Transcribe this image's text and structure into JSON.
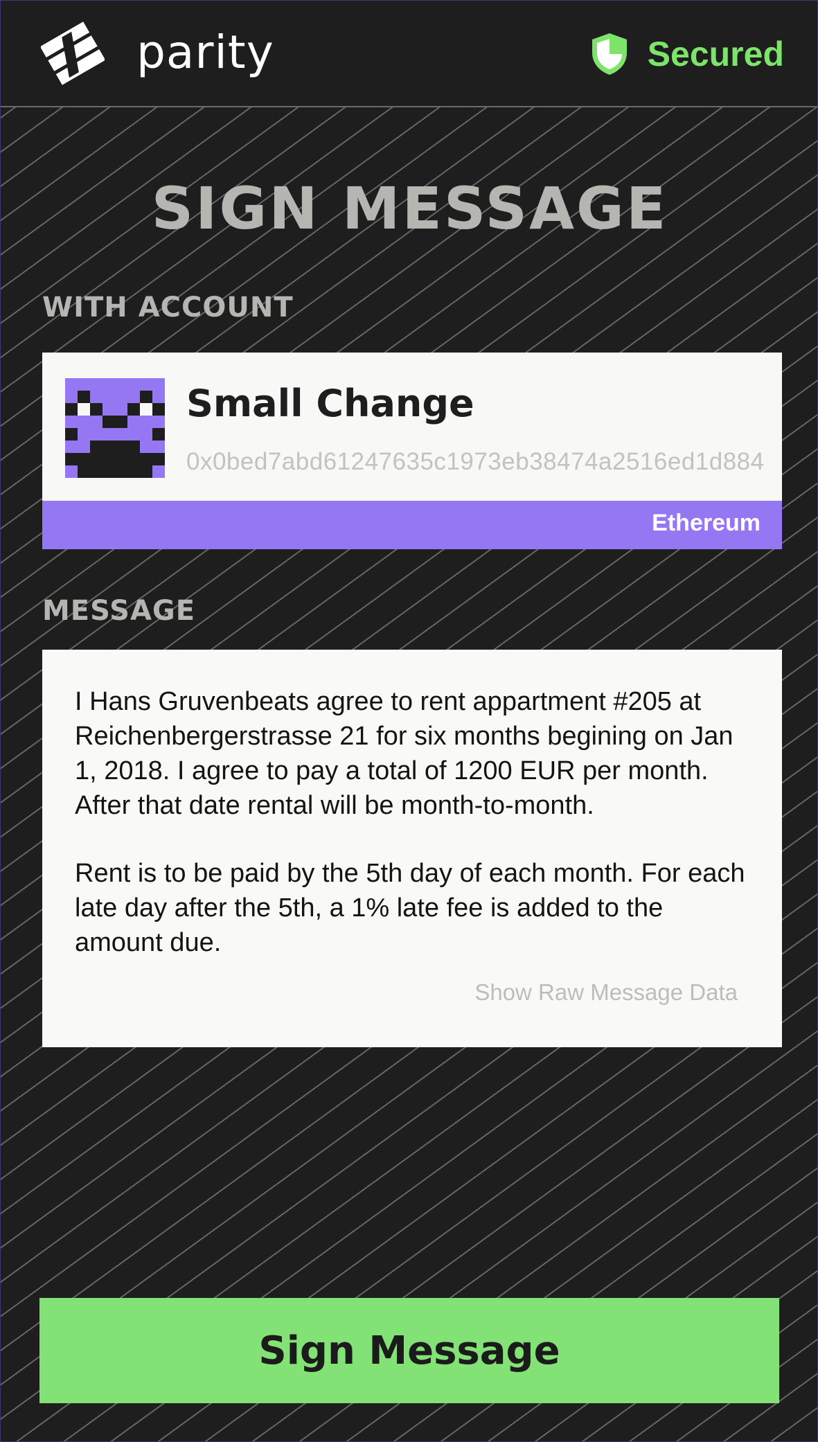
{
  "header": {
    "brand": "parity",
    "logo_icon": "parity-logo-icon",
    "status_icon": "shield-icon",
    "status_label": "Secured",
    "status_color": "#7de36a"
  },
  "page": {
    "title": "SIGN MESSAGE"
  },
  "account_section": {
    "label": "WITH ACCOUNT",
    "account": {
      "name": "Small Change",
      "address": "0x0bed7abd61247635c1973eb38474a2516ed1d884",
      "network": "Ethereum",
      "network_color": "#9677f3",
      "identicon_colors": [
        "#9677f3",
        "#1e1e1e",
        "#f8f8f7"
      ]
    }
  },
  "message_section": {
    "label": "MESSAGE",
    "paragraphs": [
      "I Hans Gruvenbeats agree to rent appartment #205 at Reichenbergerstrasse 21 for six months begining on Jan 1, 2018. I agree to pay a total of 1200 EUR per month. After that date rental will be month-to-month.",
      "Rent is to be paid by the 5th day of each month. For each late day after the 5th, a 1% late fee is added to the amount due."
    ],
    "raw_link_label": "Show Raw Message Data"
  },
  "actions": {
    "sign_label": "Sign Message",
    "sign_color": "#82e275"
  }
}
